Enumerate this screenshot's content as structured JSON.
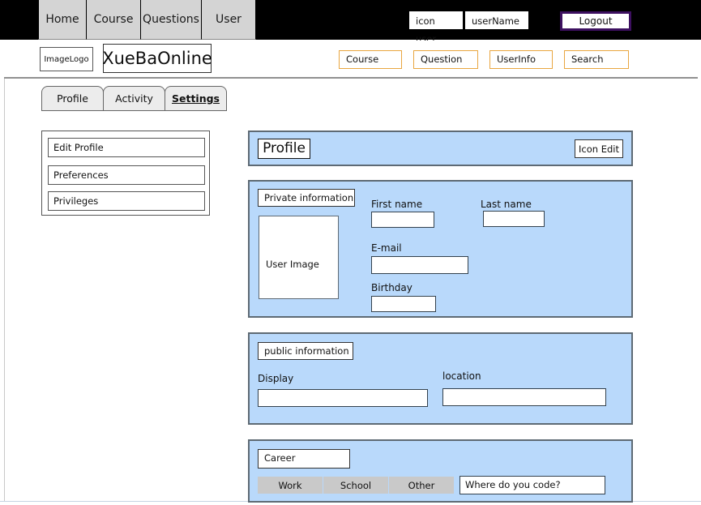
{
  "topbar": {
    "tabs": [
      {
        "label": "Home"
      },
      {
        "label": "Course"
      },
      {
        "label": "Questions"
      },
      {
        "label": "User"
      }
    ],
    "icon_user": "icon user",
    "user_name": "userName",
    "logout_label": "Logout",
    "background": "#000000",
    "logout_border": "#3d1060"
  },
  "header": {
    "logo_label": "ImageLogo",
    "brand": "XueBaOnline",
    "links": [
      {
        "label": "Course"
      },
      {
        "label": "Question"
      },
      {
        "label": "UserInfo"
      },
      {
        "label": "Search"
      }
    ],
    "link_border": "#e9a640"
  },
  "section_tabs": [
    {
      "label": "Profile",
      "active": false
    },
    {
      "label": "Activity",
      "active": false
    },
    {
      "label": "Settings",
      "active": true
    }
  ],
  "sidebar": {
    "items": [
      {
        "label": "Edit Profile"
      },
      {
        "label": "Preferences"
      },
      {
        "label": "Privileges"
      }
    ]
  },
  "profile_panel": {
    "title": "Profile",
    "edit_button": "Icon Edit",
    "panel_color": "#b9d9fb"
  },
  "private_panel": {
    "section_label": "Private information",
    "user_image_label": "User Image",
    "fields": [
      {
        "label": "First name",
        "value": "",
        "placeholder": ""
      },
      {
        "label": "Last name",
        "value": "",
        "placeholder": ""
      },
      {
        "label": "E-mail",
        "value": "",
        "placeholder": ""
      },
      {
        "label": "Birthday",
        "value": "",
        "placeholder": ""
      }
    ]
  },
  "public_panel": {
    "section_label": "public information",
    "fields": [
      {
        "label": "Display",
        "value": "",
        "placeholder": ""
      },
      {
        "label": "location",
        "value": "",
        "placeholder": ""
      }
    ]
  },
  "career_panel": {
    "section_label": "Career",
    "buttons": [
      {
        "label": "Work"
      },
      {
        "label": "School"
      },
      {
        "label": "Other"
      }
    ],
    "input_value": "Where do you code?"
  }
}
